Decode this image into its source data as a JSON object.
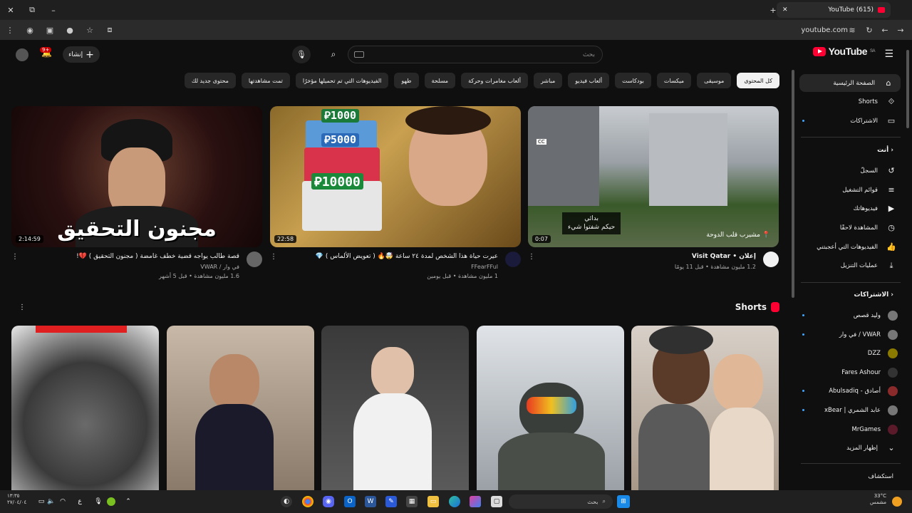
{
  "browser": {
    "tab_title": "(615) YouTube",
    "url": "youtube.com"
  },
  "header": {
    "logo_text": "YouTube",
    "logo_region": "SA",
    "search_placeholder": "بحث",
    "create_label": "إنشاء",
    "notification_count": "9+"
  },
  "chips": [
    {
      "label": "كل المحتوى"
    },
    {
      "label": "موسيقى"
    },
    {
      "label": "ميكسات"
    },
    {
      "label": "بودكاست"
    },
    {
      "label": "ألعاب فيديو"
    },
    {
      "label": "مباشر"
    },
    {
      "label": "ألعاب مغامرات وحركة"
    },
    {
      "label": "مسلحة"
    },
    {
      "label": "طهو"
    },
    {
      "label": "الفيديوهات التي تم تحميلها مؤخرًا"
    },
    {
      "label": "تمت مشاهدتها"
    },
    {
      "label": "محتوى جديد لك"
    }
  ],
  "sidebar": {
    "main": [
      {
        "label": "الصفحة الرئيسية"
      },
      {
        "label": "Shorts"
      },
      {
        "label": "الاشتراكات"
      }
    ],
    "you_heading": "أنت",
    "you": [
      {
        "label": "السجلّ"
      },
      {
        "label": "قوائم التشغيل"
      },
      {
        "label": "فيديوهاتك"
      },
      {
        "label": "المشاهدة لاحقًا"
      },
      {
        "label": "الفيديوهات التي أعجبتني"
      },
      {
        "label": "عمليات التنزيل"
      }
    ],
    "subs_heading": "الاشتراكات",
    "subscriptions": [
      {
        "label": "وليد قصص"
      },
      {
        "label": "في وار / VWAR"
      },
      {
        "label": "DZZ"
      },
      {
        "label": "Fares Ashour"
      },
      {
        "label": "Abulsadiq - أصادق"
      },
      {
        "label": "xBear | عابد الشمري"
      },
      {
        "label": "MrGames"
      },
      {
        "label": "إظهار المزيد"
      }
    ],
    "explore_heading": "استكشاف"
  },
  "videos": [
    {
      "title": "قصة طالب يواجه قضية خطف غامضة ( مجنون التحقيق ) 💔!",
      "channel": "في وار / VWAR",
      "stats": "1.6 مليون مشاهدة • قبل 5 أشهر",
      "duration": "2:14:59",
      "thumb_text": "مجنون التحقيق"
    },
    {
      "title": "عيرت حياة هذا الشخص لمدة ٢٤ ساعة 🤯🔥 ( تعويض الألماس ) 💎",
      "channel": "FFearFFul",
      "stats": "1 مليون مشاهدة • قبل يومين",
      "duration": "22:58",
      "prices": [
        "⃁1000",
        "⃁5000",
        "⃁10000"
      ]
    },
    {
      "title": "إعلان",
      "channel": "Visit Qatar",
      "stats": "1.2 مليون مشاهدة • قبل 11 يومًا",
      "duration": "0:07",
      "caption_line1": "بدائي",
      "caption_line2": "حيكم شفتوا شيء",
      "location": "مشيرب قلب الدوحة"
    }
  ],
  "shorts_heading": "Shorts",
  "taskbar": {
    "search_label": "بحث",
    "time": "١٣:٣٥",
    "date": "٢٧/٠٤/٠٤",
    "temp": "33°C",
    "weather": "مشمس"
  },
  "colors": {
    "background": "#0f0f0f",
    "accent": "#ff0033",
    "chip_bg": "#272727"
  }
}
